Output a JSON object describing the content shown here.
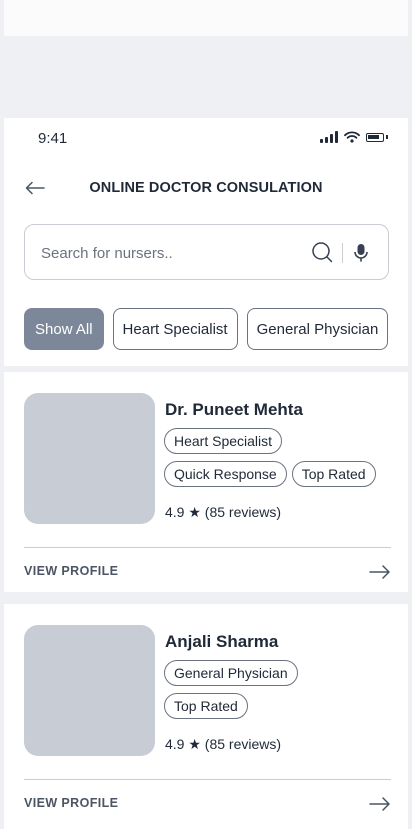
{
  "status_bar": {
    "time": "9:41"
  },
  "header": {
    "title": "ONLINE DOCTOR CONSULATION"
  },
  "search": {
    "placeholder": "Search for nursers.."
  },
  "filters": [
    "Show All",
    "Heart Specialist",
    "General Physician"
  ],
  "doctors": [
    {
      "name": "Dr. Puneet Mehta",
      "tags": [
        "Heart Specialist",
        "Quick Response",
        "Top Rated"
      ],
      "rating": "4.9 ★ (85 reviews)",
      "cta": "VIEW PROFILE"
    },
    {
      "name": "Anjali Sharma",
      "tags": [
        "General Physician",
        "Top Rated"
      ],
      "rating": "4.9 ★ (85 reviews)",
      "cta": "VIEW PROFILE"
    }
  ],
  "colors": {
    "accent_chip": "#7c8799",
    "photo_placeholder": "#c8ccd4",
    "page_bg": "#eef0f3",
    "text": "#1f2937"
  }
}
